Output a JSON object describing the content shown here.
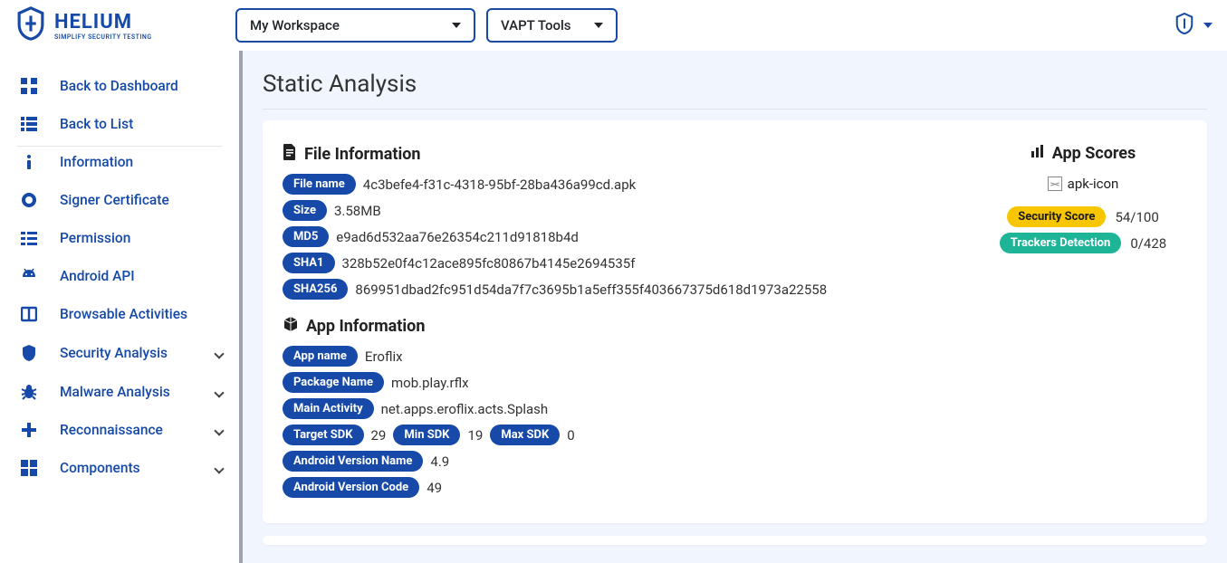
{
  "header": {
    "brand_main": "HELIUM",
    "brand_sub": "SIMPLIFY SECURITY TESTING",
    "workspace": "My Workspace",
    "tools": "VAPT Tools"
  },
  "sidebar": {
    "items": [
      {
        "label": "Back to Dashboard",
        "icon": "dashboard"
      },
      {
        "label": "Back to List",
        "icon": "list-alt"
      },
      {
        "label": "Information",
        "icon": "info"
      },
      {
        "label": "Signer Certificate",
        "icon": "certificate"
      },
      {
        "label": "Permission",
        "icon": "permissions"
      },
      {
        "label": "Android API",
        "icon": "android"
      },
      {
        "label": "Browsable Activities",
        "icon": "browsable"
      },
      {
        "label": "Security Analysis",
        "icon": "shield",
        "expandable": true
      },
      {
        "label": "Malware Analysis",
        "icon": "bug",
        "expandable": true
      },
      {
        "label": "Reconnaissance",
        "icon": "plus",
        "expandable": true
      },
      {
        "label": "Components",
        "icon": "components",
        "expandable": true
      }
    ]
  },
  "page": {
    "title": "Static Analysis"
  },
  "file_info": {
    "heading": "File Information",
    "labels": {
      "file_name": "File name",
      "size": "Size",
      "md5": "MD5",
      "sha1": "SHA1",
      "sha256": "SHA256"
    },
    "file_name": "4c3befe4-f31c-4318-95bf-28ba436a99cd.apk",
    "size": "3.58MB",
    "md5": "e9ad6d532aa76e26354c211d91818b4d",
    "sha1": "328b52e0f4c12ace895fc80867b4145e2694535f",
    "sha256": "869951dbad2fc951d54da7f7c3695b1a5eff355f403667375d618d1973a22558"
  },
  "app_info": {
    "heading": "App Information",
    "labels": {
      "app_name": "App name",
      "package_name": "Package Name",
      "main_activity": "Main Activity",
      "target_sdk": "Target SDK",
      "min_sdk": "Min SDK",
      "max_sdk": "Max SDK",
      "version_name": "Android Version Name",
      "version_code": "Android Version Code"
    },
    "app_name": "Eroflix",
    "package_name": "mob.play.rflx",
    "main_activity": "net.apps.eroflix.acts.Splash",
    "target_sdk": "29",
    "min_sdk": "19",
    "max_sdk": "0",
    "version_name": "4.9",
    "version_code": "49"
  },
  "scores": {
    "heading": "App Scores",
    "apk_icon_alt": "apk-icon",
    "labels": {
      "security": "Security Score",
      "trackers": "Trackers Detection"
    },
    "security": "54/100",
    "trackers": "0/428"
  }
}
